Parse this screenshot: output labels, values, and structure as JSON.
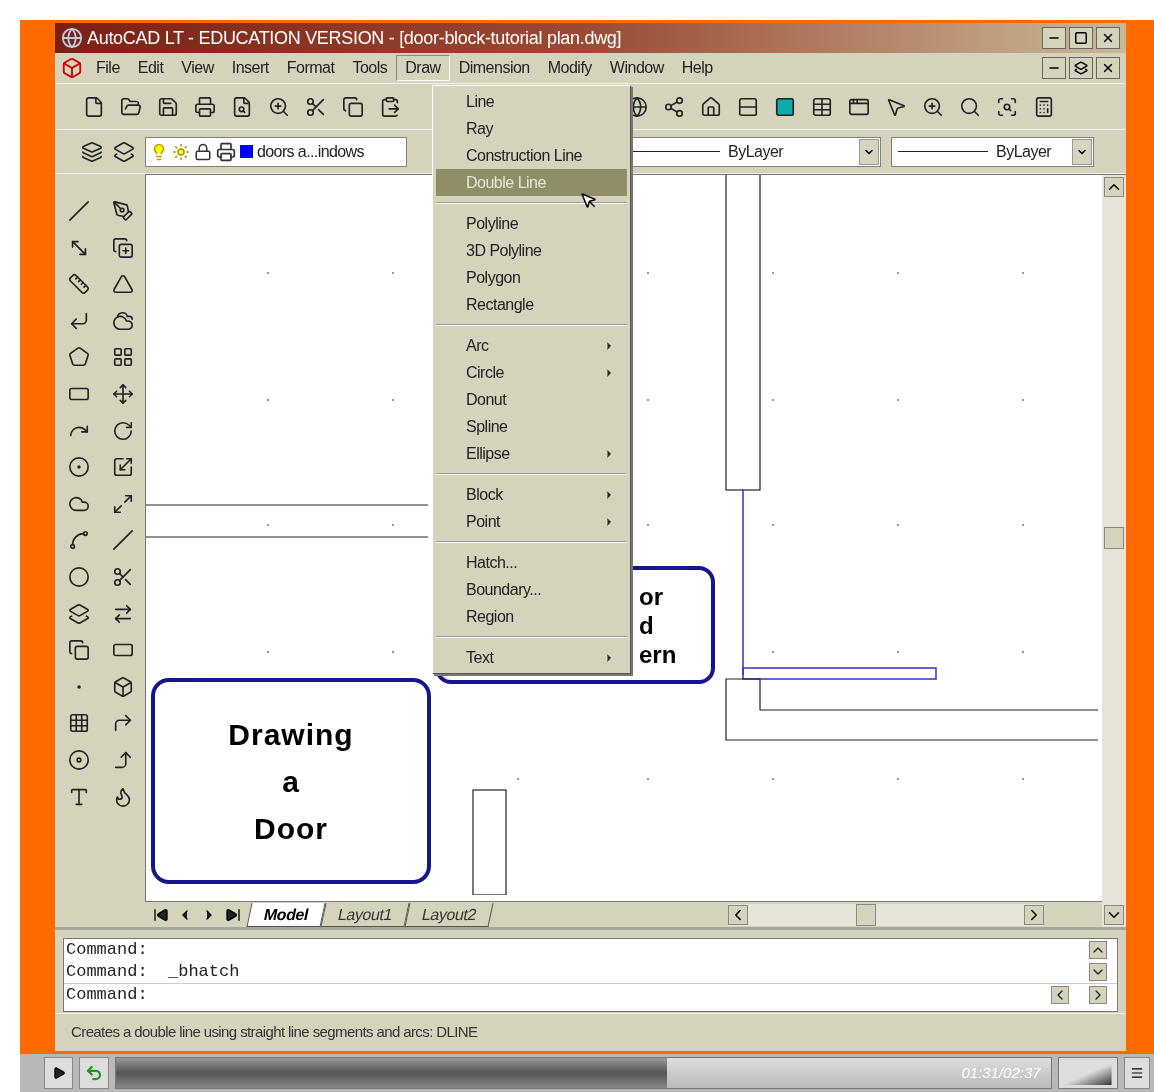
{
  "window": {
    "title": "AutoCAD LT - EDUCATION VERSION - [door-block-tutorial plan.dwg]"
  },
  "menu_bar": [
    {
      "label": "File",
      "selected": false
    },
    {
      "label": "Edit",
      "selected": false
    },
    {
      "label": "View",
      "selected": false
    },
    {
      "label": "Insert",
      "selected": false
    },
    {
      "label": "Format",
      "selected": false
    },
    {
      "label": "Tools",
      "selected": false
    },
    {
      "label": "Draw",
      "selected": true
    },
    {
      "label": "Dimension",
      "selected": false
    },
    {
      "label": "Modify",
      "selected": false
    },
    {
      "label": "Window",
      "selected": false
    },
    {
      "label": "Help",
      "selected": false
    }
  ],
  "draw_menu": {
    "groups": [
      [
        {
          "label": "Line",
          "submenu": false,
          "selected": false
        },
        {
          "label": "Ray",
          "submenu": false,
          "selected": false
        },
        {
          "label": "Construction Line",
          "submenu": false,
          "selected": false
        },
        {
          "label": "Double Line",
          "submenu": false,
          "selected": true
        }
      ],
      [
        {
          "label": "Polyline",
          "submenu": false,
          "selected": false
        },
        {
          "label": "3D Polyline",
          "submenu": false,
          "selected": false
        },
        {
          "label": "Polygon",
          "submenu": false,
          "selected": false
        },
        {
          "label": "Rectangle",
          "submenu": false,
          "selected": false
        }
      ],
      [
        {
          "label": "Arc",
          "submenu": true,
          "selected": false
        },
        {
          "label": "Circle",
          "submenu": true,
          "selected": false
        },
        {
          "label": "Donut",
          "submenu": false,
          "selected": false
        },
        {
          "label": "Spline",
          "submenu": false,
          "selected": false
        },
        {
          "label": "Ellipse",
          "submenu": true,
          "selected": false
        }
      ],
      [
        {
          "label": "Block",
          "submenu": true,
          "selected": false
        },
        {
          "label": "Point",
          "submenu": true,
          "selected": false
        }
      ],
      [
        {
          "label": "Hatch...",
          "submenu": false,
          "selected": false
        },
        {
          "label": "Boundary...",
          "submenu": false,
          "selected": false
        },
        {
          "label": "Region",
          "submenu": false,
          "selected": false
        }
      ],
      [
        {
          "label": "Text",
          "submenu": true,
          "selected": false
        }
      ]
    ]
  },
  "layer_field": {
    "value": "doors a...indows"
  },
  "linetype_field": {
    "value": "ByLayer"
  },
  "lineweight_field": {
    "value": "ByLayer"
  },
  "canvas": {
    "callouts": [
      {
        "lines": [
          "Drawing",
          "a",
          "Door"
        ]
      },
      {
        "lines": [
          "or",
          "d",
          "ern"
        ]
      }
    ]
  },
  "layout_tabs": [
    {
      "label": "Model",
      "selected": true
    },
    {
      "label": "Layout1",
      "selected": false
    },
    {
      "label": "Layout2",
      "selected": false
    }
  ],
  "command_history": [
    "Command:",
    "Command:  _bhatch"
  ],
  "command_prompt": "Command:",
  "status_text": "Creates a double line using straight line segments and arcs:  DLINE",
  "player": {
    "time": "01:31/02:37",
    "progress": {
      "level": 0.59
    },
    "volume": {
      "level": 0.85
    }
  }
}
